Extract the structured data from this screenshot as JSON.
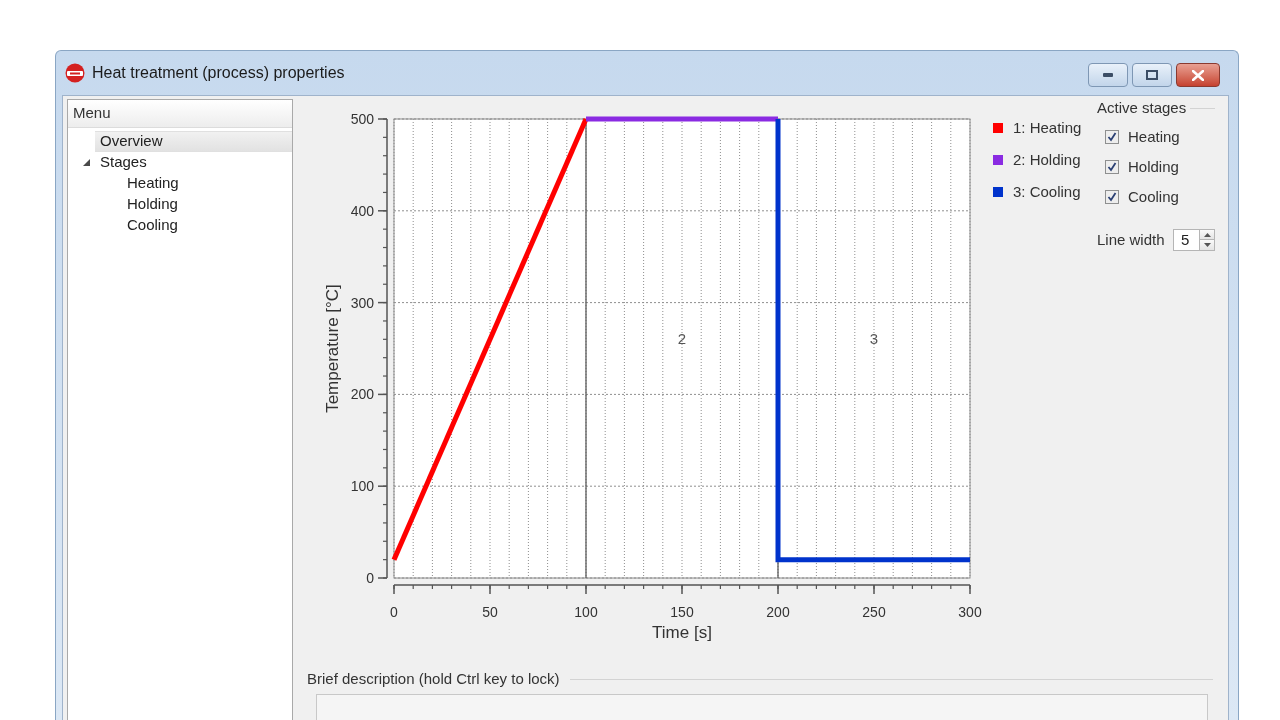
{
  "window": {
    "title": "Heat treatment (process) properties"
  },
  "menu": {
    "title": "Menu",
    "items": [
      {
        "label": "Overview",
        "selected": true
      },
      {
        "label": "Stages",
        "selected": false,
        "expanded": true,
        "children": [
          {
            "label": "Heating",
            "selected": false
          },
          {
            "label": "Holding",
            "selected": false
          },
          {
            "label": "Cooling",
            "selected": false
          }
        ]
      }
    ]
  },
  "plot": {
    "chart_data": {
      "type": "line",
      "xlabel": "Time [s]",
      "ylabel": "Temperature [°C]",
      "x": [
        0,
        100,
        200,
        200,
        300
      ],
      "series": [
        {
          "name": "1: Heating",
          "color": "#ff0000",
          "values": [
            20,
            500,
            null,
            null,
            null
          ]
        },
        {
          "name": "2: Holding",
          "color": "#8a2be2",
          "values": [
            null,
            500,
            500,
            null,
            null
          ]
        },
        {
          "name": "3: Cooling",
          "color": "#0033cc",
          "values": [
            null,
            null,
            500,
            20,
            20
          ]
        }
      ],
      "xlim": [
        0,
        300
      ],
      "ylim": [
        0,
        500
      ],
      "xticks": [
        0,
        50,
        100,
        150,
        200,
        250,
        300
      ],
      "yticks": [
        0,
        100,
        200,
        300,
        400,
        500
      ],
      "grid": true,
      "annotations": [
        "2",
        "3"
      ]
    }
  },
  "active_stages": {
    "title": "Active stages",
    "items": [
      {
        "label": "Heating",
        "checked": true
      },
      {
        "label": "Holding",
        "checked": true
      },
      {
        "label": "Cooling",
        "checked": true
      }
    ]
  },
  "line_width": {
    "label": "Line width",
    "value": "5"
  },
  "description": {
    "label": "Brief description (hold Ctrl key to lock)"
  }
}
